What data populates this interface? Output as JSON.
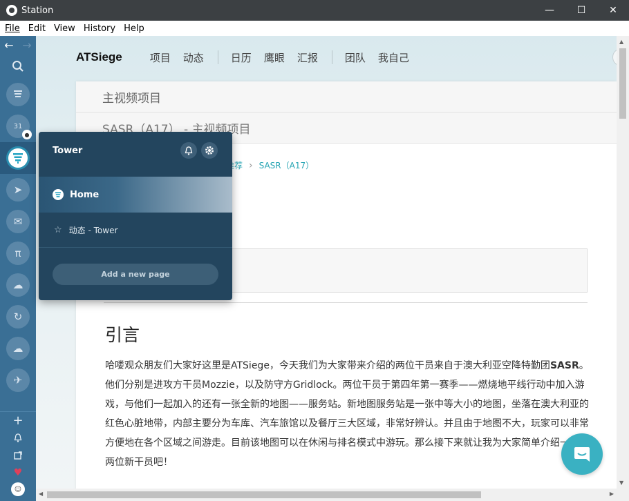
{
  "window": {
    "title": "Station",
    "minimize": "—",
    "maximize": "☐",
    "close": "✕"
  },
  "menu": {
    "items": [
      "File",
      "Edit",
      "View",
      "History",
      "Help"
    ]
  },
  "dock": {
    "back": "←",
    "forward": "→",
    "calendar_badge": "31",
    "bottom": {
      "add": "+",
      "bell": "🔔",
      "heart": "♥"
    }
  },
  "app": {
    "brand": "ATSiege",
    "nav": [
      "项目",
      "动态",
      "日历",
      "鹰眼",
      "汇报",
      "团队",
      "我自己"
    ]
  },
  "content": {
    "header1": "主视频项目",
    "header2": "SASR（A17） - 主视频项目",
    "breadcrumb": {
      "parent": "推荐",
      "current": "SASR（A17）"
    },
    "heading": "引言",
    "paragraph_1": "哈喽观众朋友们大家好这里是ATSiege，今天我们为大家带来介绍的两位干员来自于澳大利亚空降特勤团",
    "paragraph_bold": "SASR",
    "paragraph_2": "。他们分别是进攻方干员Mozzie，以及防守方Gridlock。两位干员于第四年第一赛季——燃烧地平线行动中加入游戏，与他们一起加入的还有一张全新的地图——服务站。新地图服务站是一张中等大小的地图，坐落在澳大利亚的红色心脏地带，内部主要分为车库、汽车旅馆以及餐厅三大区域，非常好辨认。并且由于地图不大，玩家可以非常方便地在各个区域之间游走。目前该地图可以在休闲与排名模式中游玩。那么接下来就让我为大家简单介绍一下这两位新干员吧！"
  },
  "popover": {
    "title": "Tower",
    "home": "Home",
    "item": "动态 - Tower",
    "add_page": "Add a new page"
  },
  "colors": {
    "dock": "#3a6f95",
    "accent": "#3ab1c2",
    "popover": "#23455e"
  }
}
